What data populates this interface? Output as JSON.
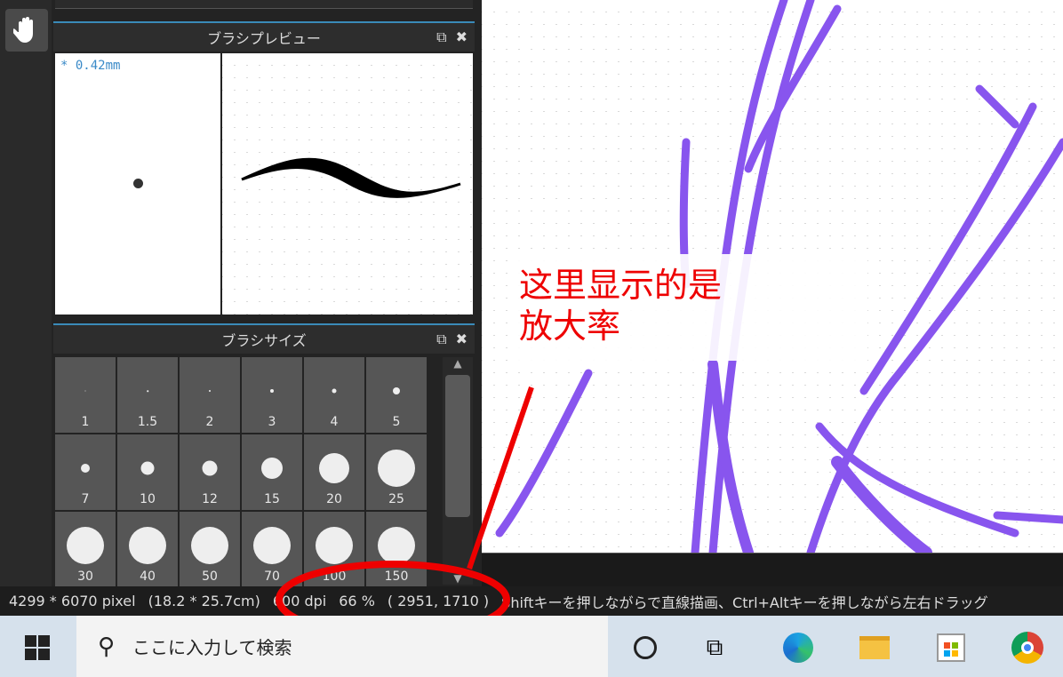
{
  "brush_preview": {
    "title": "ブラシプレビュー",
    "size": "* 0.42mm"
  },
  "brush_size": {
    "title": "ブラシサイズ",
    "sizes": [
      "1",
      "1.5",
      "2",
      "3",
      "4",
      "5",
      "7",
      "10",
      "12",
      "15",
      "20",
      "25",
      "30",
      "40",
      "50",
      "70",
      "100",
      "150"
    ]
  },
  "status": {
    "pixels": "4299 * 6070 pixel",
    "cm": "(18.2 * 25.7cm)",
    "dpi": "600 dpi",
    "zoom": "66 %",
    "coords": "( 2951, 1710 )",
    "hint": "Shiftキーを押しながらで直線描画、Ctrl+Altキーを押しながら左右ドラッグ"
  },
  "annotation": {
    "line1": "这里显示的是",
    "line2": "放大率",
    "color": "#ff0000"
  },
  "taskbar": {
    "search_placeholder": "ここに入力して検索"
  },
  "colors": {
    "stroke": "#8855ee",
    "accent": "#3a8ab8"
  }
}
